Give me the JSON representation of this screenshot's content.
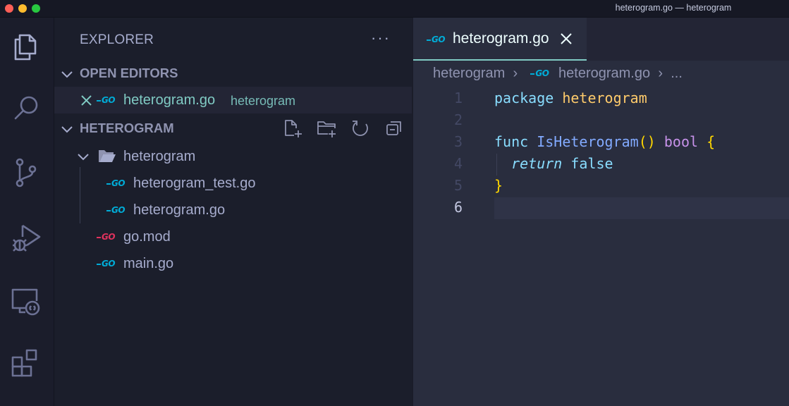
{
  "window": {
    "title": "heterogram.go — heterogram"
  },
  "activity_bar": {
    "items": [
      {
        "name": "explorer",
        "icon": "files-icon"
      },
      {
        "name": "search",
        "icon": "search-icon"
      },
      {
        "name": "source-control",
        "icon": "source-control-icon"
      },
      {
        "name": "run-debug",
        "icon": "run-debug-icon"
      },
      {
        "name": "remote-explorer",
        "icon": "remote-explorer-icon"
      },
      {
        "name": "extensions",
        "icon": "extensions-icon"
      }
    ]
  },
  "sidebar": {
    "title": "EXPLORER",
    "more_actions": "···",
    "open_editors": {
      "label": "OPEN EDITORS",
      "items": [
        {
          "file": "heterogram.go",
          "folder": "heterogram",
          "icon": "go-file-icon"
        }
      ]
    },
    "workspace": {
      "label": "HETEROGRAM",
      "actions": [
        "new-file-icon",
        "new-folder-icon",
        "refresh-icon",
        "collapse-all-icon"
      ],
      "tree": [
        {
          "name": "heterogram",
          "type": "folder",
          "expanded": true
        },
        {
          "name": "heterogram_test.go",
          "type": "file",
          "icon": "go-file-icon"
        },
        {
          "name": "heterogram.go",
          "type": "file",
          "icon": "go-file-icon"
        },
        {
          "name": "go.mod",
          "type": "file",
          "icon": "go-mod-icon"
        },
        {
          "name": "main.go",
          "type": "file",
          "icon": "go-file-icon"
        }
      ]
    }
  },
  "editor": {
    "tab": {
      "label": "heterogram.go",
      "icon": "go-file-icon"
    },
    "breadcrumb": [
      "heterogram",
      "heterogram.go",
      "..."
    ],
    "line_numbers": [
      "1",
      "2",
      "3",
      "4",
      "5",
      "6"
    ],
    "current_line": 6,
    "code": {
      "l1_kw": "package",
      "l1_name": "heterogram",
      "l3_kw": "func",
      "l3_fn": "IsHeterogram",
      "l3_parens": "()",
      "l3_type": "bool",
      "l3_brace": "{",
      "l4_kw": "return",
      "l4_val": "false",
      "l5_brace": "}"
    }
  },
  "colors": {
    "accent": "#80cbc4",
    "go_icon": "#00acd7",
    "go_mod_icon": "#e0325d",
    "editor_bg": "#292d3e",
    "sidebar_bg": "#1b1e2b"
  }
}
